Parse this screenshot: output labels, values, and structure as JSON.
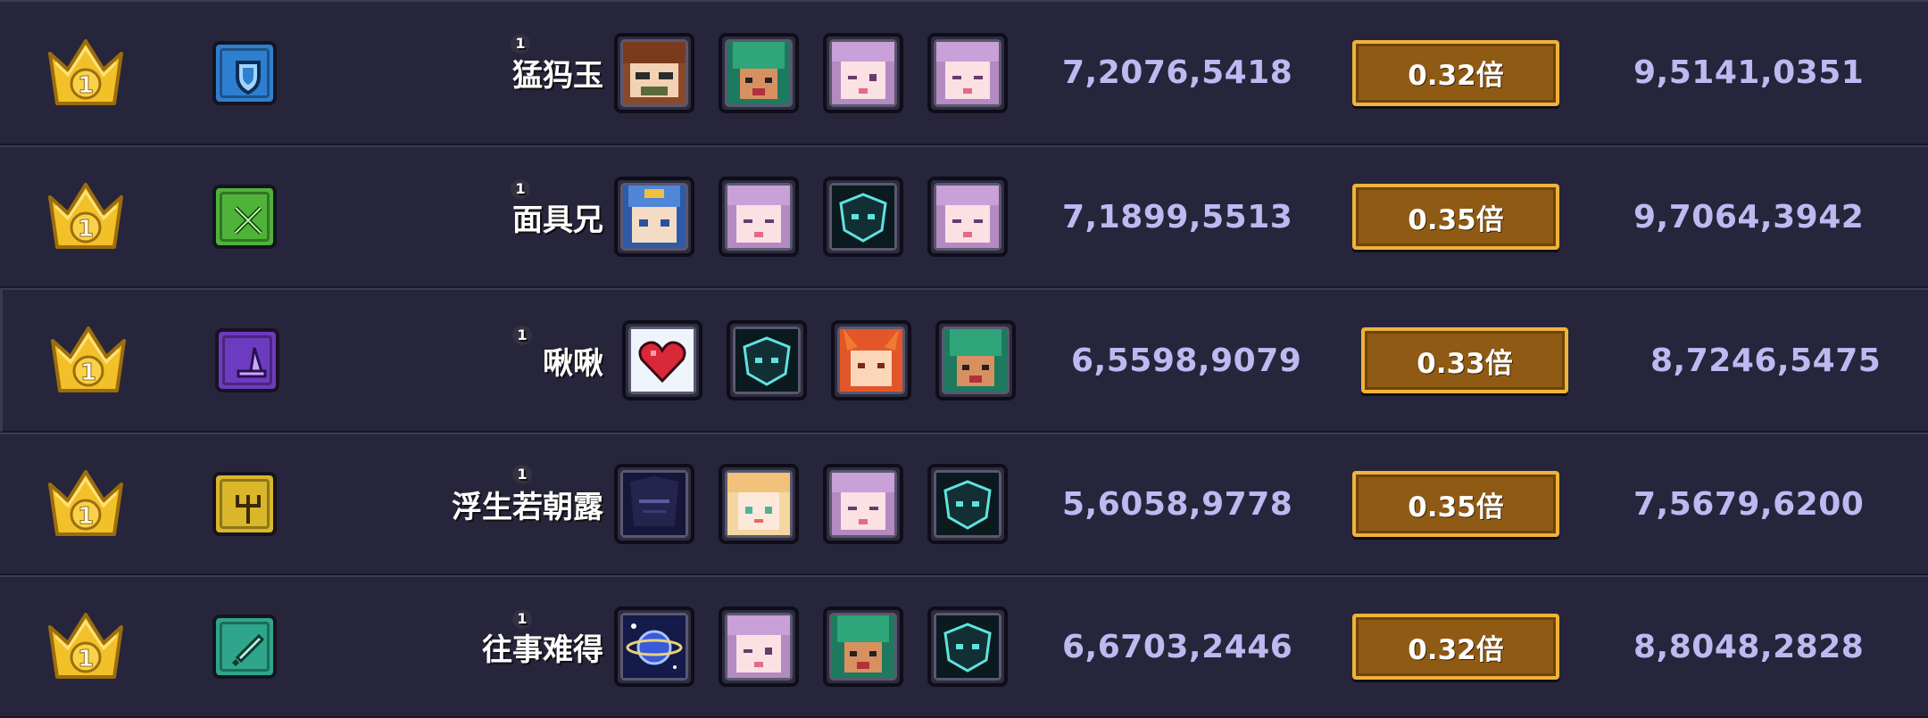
{
  "rows": [
    {
      "rank": "1",
      "class_icon": "shield-icon",
      "class_color": "#2f7fd0",
      "name_rank_sup": "1",
      "player_name": "猛犸玉",
      "heroes": [
        "hero-brown-hair-glasses",
        "hero-green-cat-hood",
        "hero-pink-hair-wink",
        "hero-pink-hair-smile"
      ],
      "damage": "7,2076,5418",
      "multiplier": "0.32倍",
      "total": "9,5141,0351"
    },
    {
      "rank": "1",
      "class_icon": "crossed-arrows-icon",
      "class_color": "#4fb33a",
      "name_rank_sup": "1",
      "player_name": "面具兄",
      "heroes": [
        "hero-blue-crown-girl",
        "hero-pink-hair-smile",
        "hero-dark-spider-mask",
        "hero-pink-hair-smile"
      ],
      "damage": "7,1899,5513",
      "multiplier": "0.35倍",
      "total": "9,7064,3942"
    },
    {
      "rank": "1",
      "class_icon": "witch-hat-icon",
      "class_color": "#6d3bbf",
      "name_rank_sup": "1",
      "player_name": "啾啾",
      "heroes": [
        "hero-red-heart",
        "hero-dark-spider-mask",
        "hero-orange-fox-girl",
        "hero-green-cat-hood"
      ],
      "damage": "6,5598,9079",
      "multiplier": "0.33倍",
      "total": "8,7246,5475"
    },
    {
      "rank": "1",
      "class_icon": "trident-icon",
      "class_color": "#d9b62a",
      "name_rank_sup": "1",
      "player_name": "浮生若朝露",
      "heroes": [
        "hero-dark-shadow-mask",
        "hero-blonde-hair-girl",
        "hero-pink-hair-smile",
        "hero-dark-spider-mask"
      ],
      "damage": "5,6058,9778",
      "multiplier": "0.35倍",
      "total": "7,5679,6200"
    },
    {
      "rank": "1",
      "class_icon": "sword-icon",
      "class_color": "#2fa58b",
      "name_rank_sup": "1",
      "player_name": "往事难得",
      "heroes": [
        "hero-galaxy-planet",
        "hero-pink-hair-wink",
        "hero-green-cat-hood",
        "hero-dark-spider-mask"
      ],
      "damage": "6,6703,2446",
      "multiplier": "0.32倍",
      "total": "8,8048,2828"
    }
  ]
}
